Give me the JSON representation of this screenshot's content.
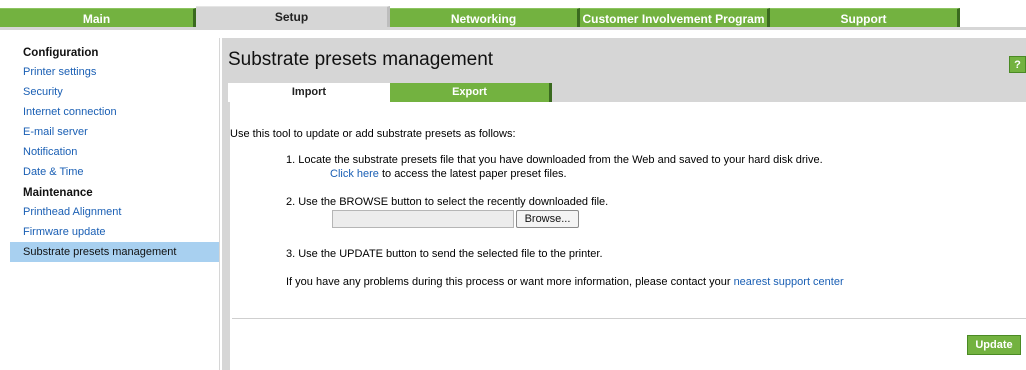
{
  "top_tabs": [
    {
      "label": "Main",
      "active": false
    },
    {
      "label": "Setup",
      "active": true
    },
    {
      "label": "Networking",
      "active": false
    },
    {
      "label": "Customer Involvement Program",
      "active": false
    },
    {
      "label": "Support",
      "active": false
    }
  ],
  "sidebar": {
    "section_configuration": "Configuration",
    "config_items": [
      "Printer settings",
      "Security",
      "Internet connection",
      "E-mail server",
      "Notification",
      "Date & Time"
    ],
    "section_maintenance": "Maintenance",
    "maintenance_items": [
      "Printhead Alignment",
      "Firmware update",
      "Substrate presets management"
    ],
    "active_item": "Substrate presets management"
  },
  "page": {
    "title": "Substrate presets management",
    "help_label": "?",
    "tabs": [
      {
        "label": "Import",
        "active": true
      },
      {
        "label": "Export",
        "active": false
      }
    ]
  },
  "content": {
    "intro": "Use this tool to update or add substrate presets as follows:",
    "step1": "1. Locate the substrate presets file that you have downloaded from the Web and saved to your hard disk drive.",
    "step1_link": "Click here",
    "step1_after": " to access the latest paper preset files.",
    "step2": "2. Use the BROWSE button to select the recently downloaded file.",
    "file_value": "",
    "browse_label": "Browse...",
    "step3": "3. Use the UPDATE button to send the selected file to the printer.",
    "help_text": "If you have any problems during this process or want more information, please contact your ",
    "help_link": "nearest support center",
    "update_label": "Update"
  },
  "colors": {
    "accent_green": "#73b240",
    "panel_gray": "#d6d6d6",
    "link_blue": "#1a5fb4",
    "active_highlight": "#a8d0f0"
  }
}
